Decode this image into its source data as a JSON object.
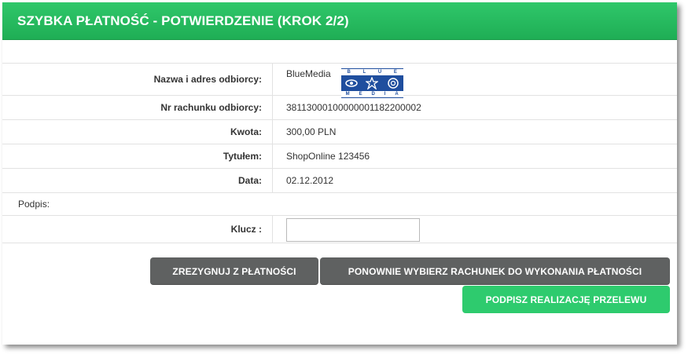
{
  "header": {
    "title": "SZYBKA PŁATNOŚĆ - POTWIERDZENIE (KROK 2/2)"
  },
  "recipient": {
    "label": "Nazwa i adres odbiorcy:",
    "value": "BlueMedia",
    "logo_top_letters": [
      "B",
      "L",
      "U",
      "E"
    ],
    "logo_bottom_letters": [
      "M",
      "E",
      "D",
      "I",
      "A"
    ]
  },
  "account": {
    "label": "Nr rachunku odbiorcy:",
    "value": "38113000100000001182200002"
  },
  "amount": {
    "label": "Kwota:",
    "value": "300,00 PLN"
  },
  "title_field": {
    "label": "Tytułem:",
    "value": "ShopOnline 123456"
  },
  "date": {
    "label": "Data:",
    "value": "02.12.2012"
  },
  "signature": {
    "label": "Podpis:"
  },
  "key": {
    "label": "Klucz :",
    "value": ""
  },
  "buttons": {
    "cancel": "ZREZYGNUJ Z PŁATNOŚCI",
    "reselect": "PONOWNIE WYBIERZ RACHUNEK DO WYKONANIA PŁATNOŚCI",
    "sign": "PODPISZ REALIZACJĘ PRZELEWU"
  },
  "colors": {
    "header": "#1fae55",
    "primary_button": "#2ecb6e",
    "secondary_button": "#5f6161"
  }
}
